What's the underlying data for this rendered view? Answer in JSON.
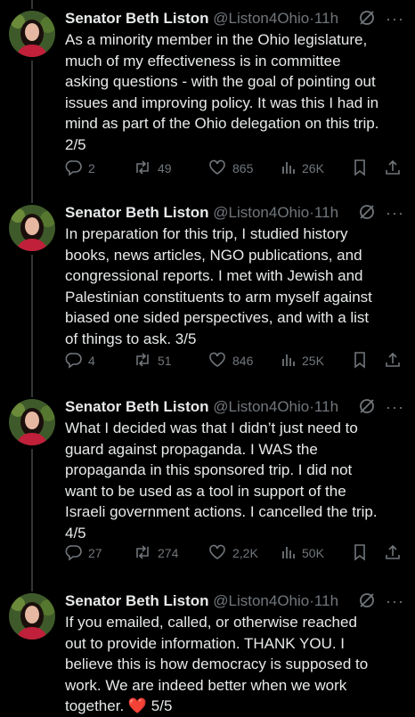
{
  "tweets": [
    {
      "author": {
        "name": "Senator Beth Liston",
        "handle": "@Liston4Ohio",
        "time": "11h"
      },
      "text": "As a minority member in the Ohio legislature,\nmuch of my effectiveness is in committee\nasking questions - with the goal of pointing out\nissues and improving policy. It was this I had in\nmind as part of the Ohio delegation on this trip.\n2/5",
      "stats": {
        "replies": "2",
        "reposts": "49",
        "likes": "865",
        "views": "26K"
      }
    },
    {
      "author": {
        "name": "Senator Beth Liston",
        "handle": "@Liston4Ohio",
        "time": "11h"
      },
      "text": "In preparation for this trip, I studied history\nbooks, news articles, NGO publications, and\ncongressional reports. I met with Jewish and\nPalestinian constituents to arm myself against\nbiased one sided perspectives, and with a list\nof things to ask. 3/5",
      "stats": {
        "replies": "4",
        "reposts": "51",
        "likes": "846",
        "views": "25K"
      }
    },
    {
      "author": {
        "name": "Senator Beth Liston",
        "handle": "@Liston4Ohio",
        "time": "11h"
      },
      "text": "What I decided was that I didn’t just need to\nguard against propaganda. I WAS the\npropaganda in this sponsored trip. I did not\nwant to be used as a tool in support of the\nIsraeli government actions. I cancelled the trip.\n4/5",
      "stats": {
        "replies": "27",
        "reposts": "274",
        "likes": "2,2K",
        "views": "50K"
      }
    },
    {
      "author": {
        "name": "Senator Beth Liston",
        "handle": "@Liston4Ohio",
        "time": "11h"
      },
      "text_main": "If you emailed, called, or otherwise reached\nout to provide information. THANK YOU. I\nbelieve this is how democracy is supposed to\nwork. We are indeed better when we work\ntogether. ",
      "text_emoji": "❤️",
      "text_tail": " 5/5"
    }
  ],
  "icons": {
    "reply": "reply-icon",
    "repost": "repost-icon",
    "like": "heart-icon",
    "views": "views-icon",
    "bookmark": "bookmark-icon",
    "share": "share-icon",
    "grok": "grok-icon",
    "more": "more-icon"
  },
  "colors": {
    "background": "#000000",
    "text": "#e7e9ea",
    "muted": "#71767b",
    "divider": "#2f3336",
    "heart_emoji": "#f91880"
  }
}
